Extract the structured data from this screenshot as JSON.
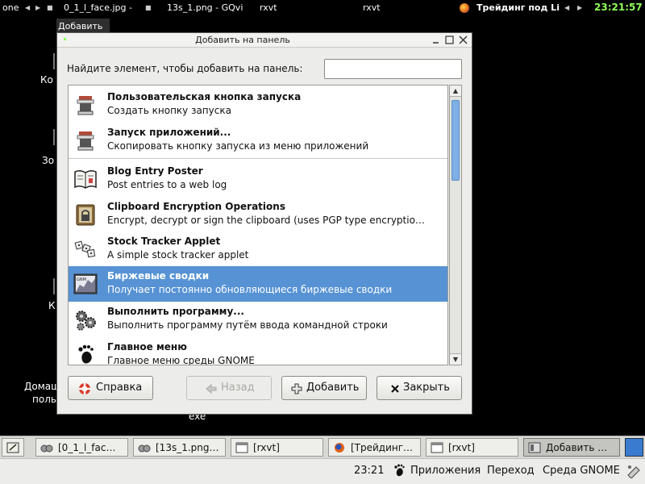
{
  "top_panel": {
    "items": [
      "one",
      "0_1_l_face.jpg -",
      "13s_1.png - GQvi",
      "rxvt",
      "rxvt",
      "Трейдинг под Li"
    ],
    "clock": "23:21:57"
  },
  "desktop": {
    "labels": [
      "Ко",
      "Зо",
      "К",
      "Домаш",
      "поль",
      "exe"
    ]
  },
  "window_tab": "Добавить",
  "dialog": {
    "title": "Добавить на панель",
    "search_label": "Найдите элемент, чтобы добавить на панель:",
    "search_value": "",
    "items": [
      {
        "title": "Пользовательская кнопка запуска",
        "desc": "Создать кнопку запуска",
        "icon": "launcher-icon"
      },
      {
        "title": "Запуск приложений...",
        "desc": "Скопировать кнопку запуска из меню приложений",
        "icon": "launcher-icon"
      },
      {
        "title": "Blog Entry Poster",
        "desc": "Post entries to a web log",
        "icon": "book-icon"
      },
      {
        "title": "Clipboard Encryption Operations",
        "desc": "Encrypt, decrypt or sign the clipboard (uses PGP type encryptio…",
        "icon": "lock-icon"
      },
      {
        "title": "Stock Tracker Applet",
        "desc": "A simple stock tracker applet",
        "icon": "dice-icon"
      },
      {
        "title": "Биржевые сводки",
        "desc": "Получает постоянно обновляющиеся биржевые сводки",
        "icon": "stock-chart-icon"
      },
      {
        "title": "Выполнить программу...",
        "desc": "Выполнить программу путём ввода командной строки",
        "icon": "gears-icon"
      },
      {
        "title": "Главное меню",
        "desc": "Главное меню среды GNOME",
        "icon": "gnome-foot-icon"
      }
    ],
    "selected_index": 5,
    "buttons": {
      "help": "Справка",
      "back": "Назад",
      "add": "Добавить",
      "close": "Закрыть"
    }
  },
  "taskbar": {
    "tasks": [
      "[0_1_l_fac…",
      "[13s_1.png…",
      "[rxvt]",
      "[Трейдинг…",
      "[rxvt]",
      "Добавить …"
    ]
  },
  "bottom_panel": {
    "clock": "23:21",
    "menus": [
      "Приложения",
      "Переход",
      "Среда GNOME"
    ]
  },
  "colors": {
    "selection": "#5793d4",
    "clock_green": "#8dff5a"
  }
}
